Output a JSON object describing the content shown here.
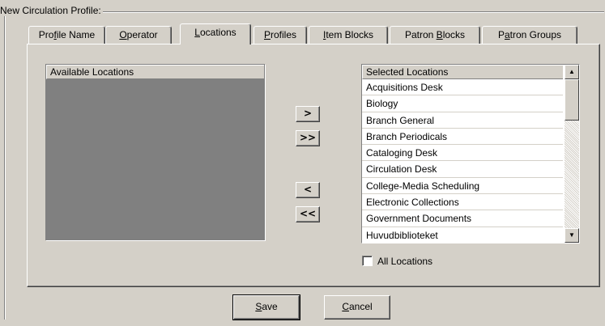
{
  "group_title": "New  Circulation Profile:",
  "tabs": [
    {
      "pre": "Pro",
      "u": "f",
      "post": "ile Name"
    },
    {
      "pre": "",
      "u": "O",
      "post": "perator"
    },
    {
      "pre": "",
      "u": "L",
      "post": "ocations"
    },
    {
      "pre": "",
      "u": "P",
      "post": "rofiles"
    },
    {
      "pre": "",
      "u": "I",
      "post": "tem Blocks"
    },
    {
      "pre": "Patron ",
      "u": "B",
      "post": "locks"
    },
    {
      "pre": "P",
      "u": "a",
      "post": "tron Groups"
    }
  ],
  "active_tab": "Locations",
  "available": {
    "header": "Available Locations",
    "items": []
  },
  "transfer_buttons": {
    "add": ">",
    "add_all": ">>",
    "remove": "<",
    "remove_all": "<<"
  },
  "selected": {
    "header": "Selected Locations",
    "items": [
      "Acquisitions Desk",
      "Biology",
      "Branch General",
      "Branch Periodicals",
      "Cataloging Desk",
      "Circulation Desk",
      "College-Media Scheduling",
      "Electronic Collections",
      "Government Documents",
      "Huvudbiblioteket"
    ]
  },
  "all_locations": {
    "label": "All Locations",
    "checked": false
  },
  "buttons": {
    "save": {
      "u": "S",
      "post": "ave"
    },
    "cancel": {
      "u": "C",
      "post": "ancel"
    }
  }
}
